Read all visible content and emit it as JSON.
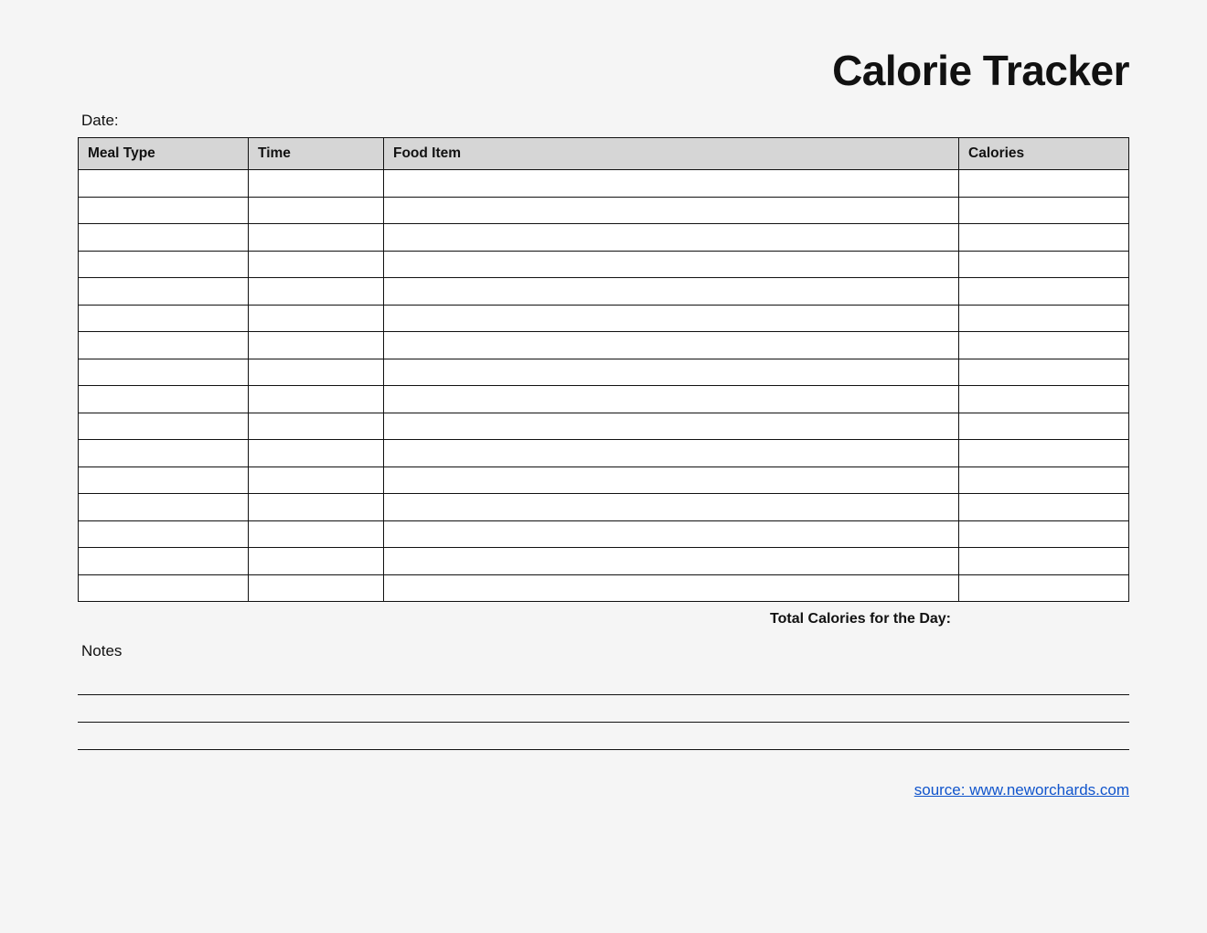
{
  "title": "Calorie Tracker",
  "date_label": "Date:",
  "columns": {
    "meal_type": "Meal Type",
    "time": "Time",
    "food_item": "Food Item",
    "calories": "Calories"
  },
  "rows": [
    {
      "meal_type": "",
      "time": "",
      "food_item": "",
      "calories": ""
    },
    {
      "meal_type": "",
      "time": "",
      "food_item": "",
      "calories": ""
    },
    {
      "meal_type": "",
      "time": "",
      "food_item": "",
      "calories": ""
    },
    {
      "meal_type": "",
      "time": "",
      "food_item": "",
      "calories": ""
    },
    {
      "meal_type": "",
      "time": "",
      "food_item": "",
      "calories": ""
    },
    {
      "meal_type": "",
      "time": "",
      "food_item": "",
      "calories": ""
    },
    {
      "meal_type": "",
      "time": "",
      "food_item": "",
      "calories": ""
    },
    {
      "meal_type": "",
      "time": "",
      "food_item": "",
      "calories": ""
    },
    {
      "meal_type": "",
      "time": "",
      "food_item": "",
      "calories": ""
    },
    {
      "meal_type": "",
      "time": "",
      "food_item": "",
      "calories": ""
    },
    {
      "meal_type": "",
      "time": "",
      "food_item": "",
      "calories": ""
    },
    {
      "meal_type": "",
      "time": "",
      "food_item": "",
      "calories": ""
    },
    {
      "meal_type": "",
      "time": "",
      "food_item": "",
      "calories": ""
    },
    {
      "meal_type": "",
      "time": "",
      "food_item": "",
      "calories": ""
    },
    {
      "meal_type": "",
      "time": "",
      "food_item": "",
      "calories": ""
    },
    {
      "meal_type": "",
      "time": "",
      "food_item": "",
      "calories": ""
    }
  ],
  "total_label": "Total Calories for the Day:",
  "total_value": "",
  "notes_label": "Notes",
  "note_lines": [
    "",
    "",
    ""
  ],
  "source_text": "source: www.neworchards.com"
}
